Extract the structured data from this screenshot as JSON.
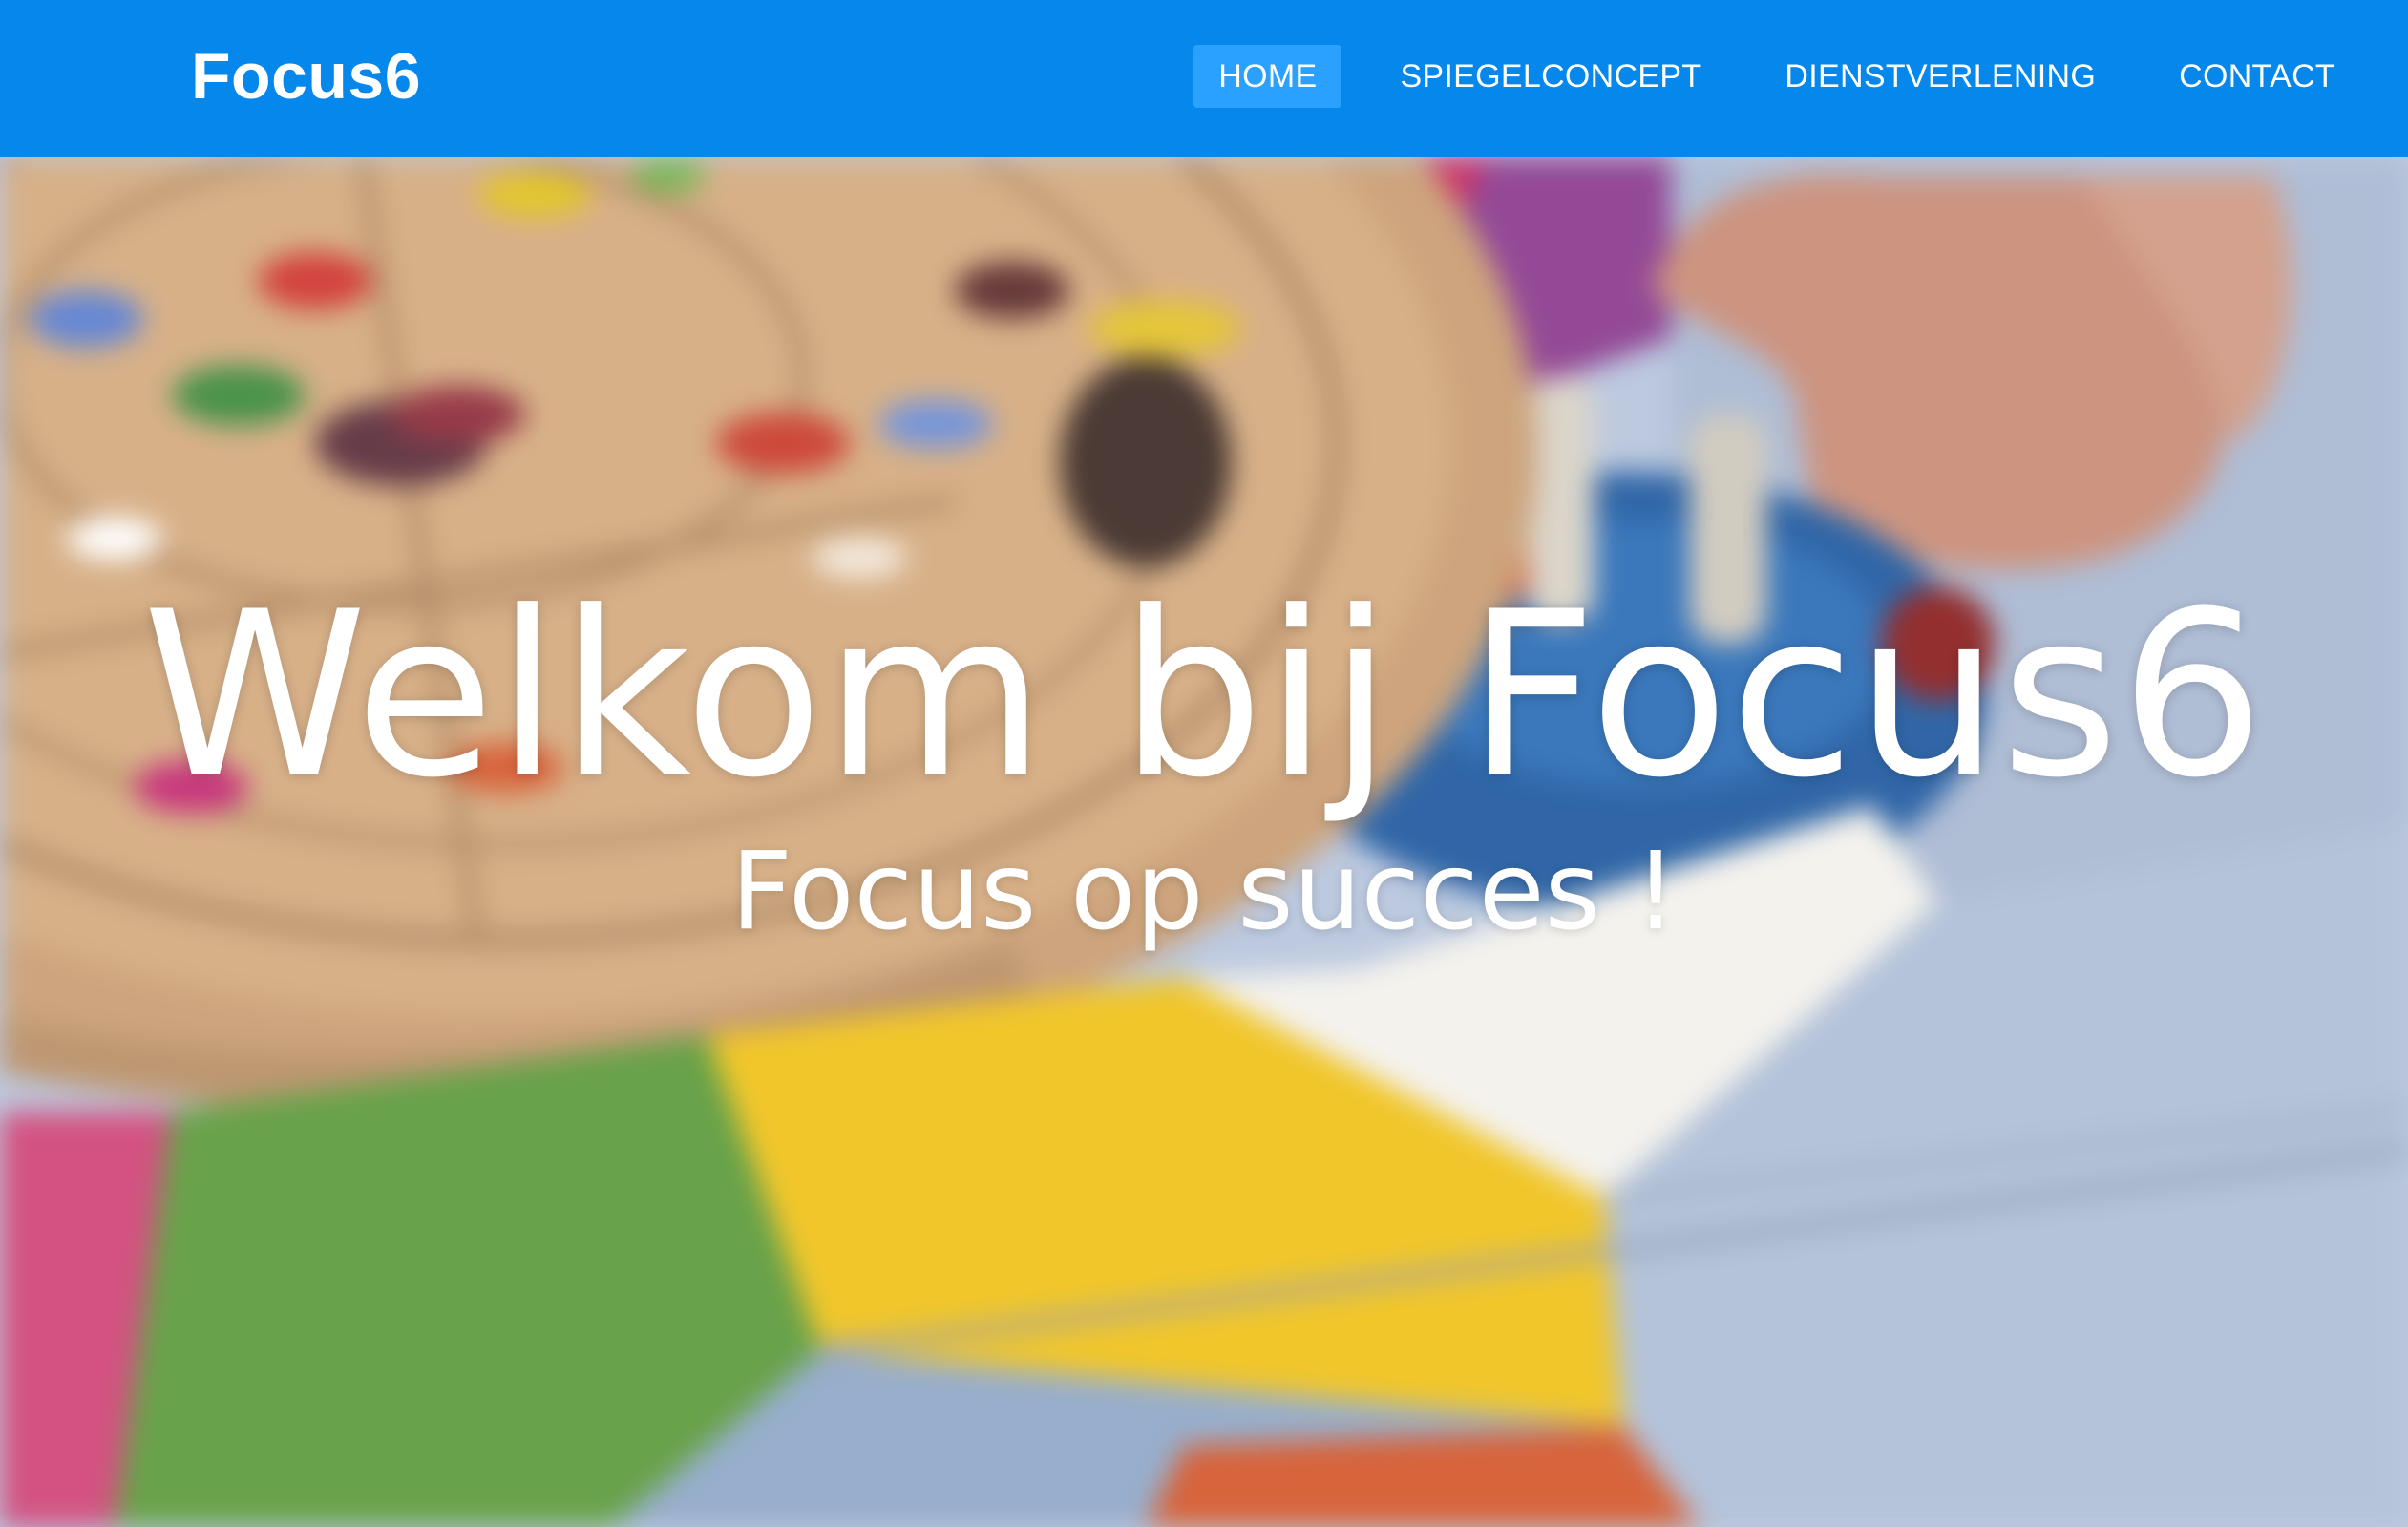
{
  "navbar": {
    "brand": "Focus6",
    "items": [
      {
        "label": "HOME",
        "active": true
      },
      {
        "label": "SPIEGELCONCEPT",
        "active": false
      },
      {
        "label": "DIENSTVERLENING",
        "active": false
      },
      {
        "label": "CONTACT",
        "active": false
      }
    ]
  },
  "hero": {
    "title": "Welkom bij Focus6",
    "subtitle": "Focus op succes !"
  },
  "colors": {
    "navbar_bg": "#0587eb",
    "active_item_bg": "#2aa0ff",
    "text": "#ffffff"
  }
}
